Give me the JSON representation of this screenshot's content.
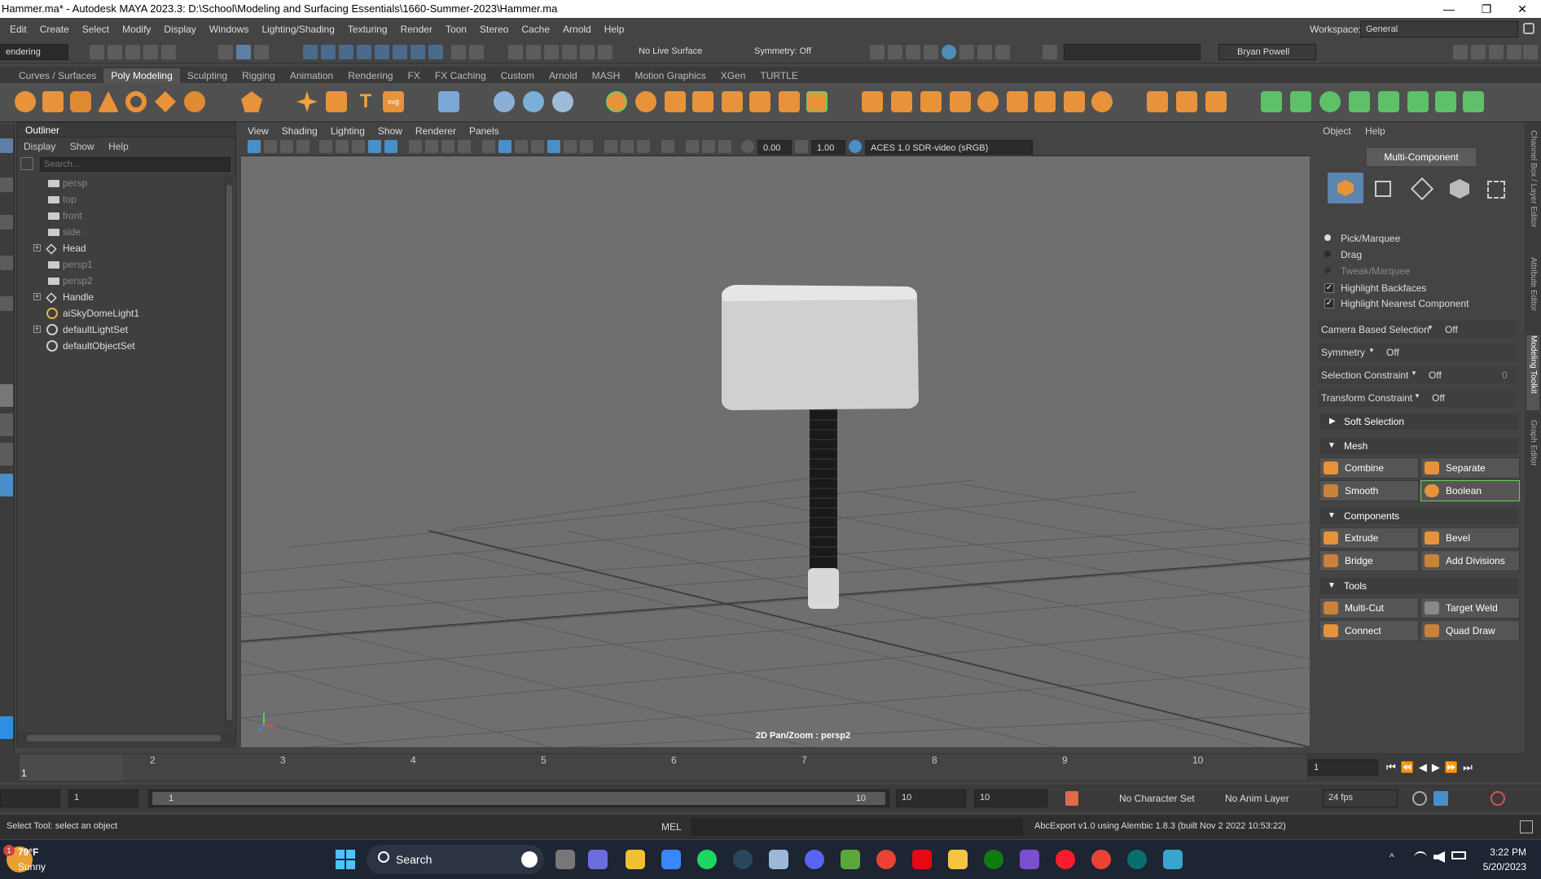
{
  "window": {
    "title": "Hammer.ma* - Autodesk MAYA 2023.3: D:\\School\\Modeling and Surfacing Essentials\\1660-Summer-2023\\Hammer.ma",
    "min": "—",
    "max": "❐",
    "close": "✕"
  },
  "menubar": {
    "items": [
      "Edit",
      "Create",
      "Select",
      "Modify",
      "Display",
      "Windows",
      "Lighting/Shading",
      "Texturing",
      "Render",
      "Toon",
      "Stereo",
      "Cache",
      "Arnold",
      "Help"
    ],
    "workspace_label": "Workspace:",
    "workspace_value": "General"
  },
  "toolbar": {
    "menuset": "endering",
    "live_surface": "No Live Surface",
    "symmetry": "Symmetry: Off",
    "user": "Bryan Powell"
  },
  "shelf": {
    "tabs": [
      "Curves / Surfaces",
      "Poly Modeling",
      "Sculpting",
      "Rigging",
      "Animation",
      "Rendering",
      "FX",
      "FX Caching",
      "Custom",
      "Arnold",
      "MASH",
      "Motion Graphics",
      "XGen",
      "TURTLE"
    ],
    "active": "Poly Modeling"
  },
  "outliner": {
    "title": "Outliner",
    "menus": [
      "Display",
      "Show",
      "Help"
    ],
    "search_placeholder": "Search...",
    "items": [
      {
        "label": "persp",
        "dim": true,
        "expand": false,
        "icon": "camera-icon"
      },
      {
        "label": "top",
        "dim": true,
        "expand": false,
        "icon": "camera-icon"
      },
      {
        "label": "front",
        "dim": true,
        "expand": false,
        "icon": "camera-icon"
      },
      {
        "label": "side",
        "dim": true,
        "expand": false,
        "icon": "camera-icon"
      },
      {
        "label": "Head",
        "dim": false,
        "expand": true,
        "icon": "transform-icon"
      },
      {
        "label": "persp1",
        "dim": true,
        "expand": false,
        "icon": "camera-icon"
      },
      {
        "label": "persp2",
        "dim": true,
        "expand": false,
        "icon": "camera-icon"
      },
      {
        "label": "Handle",
        "dim": false,
        "expand": true,
        "icon": "transform-icon"
      },
      {
        "label": "aiSkyDomeLight1",
        "dim": false,
        "expand": false,
        "icon": "skydome-icon"
      },
      {
        "label": "defaultLightSet",
        "dim": false,
        "expand": true,
        "icon": "set-icon"
      },
      {
        "label": "defaultObjectSet",
        "dim": false,
        "expand": false,
        "icon": "set-icon"
      }
    ]
  },
  "viewport": {
    "menus": [
      "View",
      "Shading",
      "Lighting",
      "Show",
      "Renderer",
      "Panels"
    ],
    "exposure": "0.00",
    "gamma": "1.00",
    "colorspace": "ACES 1.0 SDR-video (sRGB)",
    "hud": "2D Pan/Zoom : persp2"
  },
  "toolkit": {
    "menus": [
      "Object",
      "Help"
    ],
    "mode": "Multi-Component",
    "options": [
      {
        "label": "Pick/Marquee",
        "kind": "radio",
        "on": true,
        "dim": false
      },
      {
        "label": "Drag",
        "kind": "radio",
        "on": false,
        "dim": false
      },
      {
        "label": "Tweak/Marquee",
        "kind": "radio",
        "on": false,
        "dim": true
      },
      {
        "label": "Highlight Backfaces",
        "kind": "check",
        "on": true,
        "dim": false
      },
      {
        "label": "Highlight Nearest Component",
        "kind": "check",
        "on": true,
        "dim": false
      }
    ],
    "settings": [
      {
        "label": "Camera Based Selection",
        "value": "Off"
      },
      {
        "label": "Symmetry",
        "value": "Off"
      },
      {
        "label": "Selection Constraint",
        "value": "Off"
      },
      {
        "label": "Transform Constraint",
        "value": "Off"
      }
    ],
    "sel_constraint_num": "0",
    "soft_selection": "Soft Selection",
    "sections": [
      {
        "title": "Mesh",
        "buttons": [
          "Combine",
          "Separate",
          "Smooth",
          "Boolean"
        ]
      },
      {
        "title": "Components",
        "buttons": [
          "Extrude",
          "Bevel",
          "Bridge",
          "Add Divisions"
        ]
      },
      {
        "title": "Tools",
        "buttons": [
          "Multi-Cut",
          "Target Weld",
          "Connect",
          "Quad Draw"
        ]
      }
    ],
    "side_tabs": [
      "Channel Box / Layer Editor",
      "Attribute Editor",
      "Modeling Toolkit",
      "Graph Editor"
    ]
  },
  "timeline": {
    "ticks": [
      "1",
      "2",
      "3",
      "4",
      "5",
      "6",
      "7",
      "8",
      "9",
      "10"
    ],
    "current": "1",
    "current_field": "1"
  },
  "range": {
    "start": "1",
    "inner_start": "1",
    "inner_end": "10",
    "end": "10",
    "end2": "10",
    "char_set": "No Character Set",
    "anim_layer": "No Anim Layer",
    "fps": "24 fps"
  },
  "cmdline": {
    "help": "Select Tool: select an object",
    "lang": "MEL",
    "result": "AbcExport v1.0 using Alembic 1.8.3 (built Nov  2 2022 10:53:22)"
  },
  "taskbar": {
    "temp": "79°F",
    "cond": "Sunny",
    "search": "Search",
    "time": "3:22 PM",
    "date": "5/20/2023",
    "weather_badge": "1"
  }
}
